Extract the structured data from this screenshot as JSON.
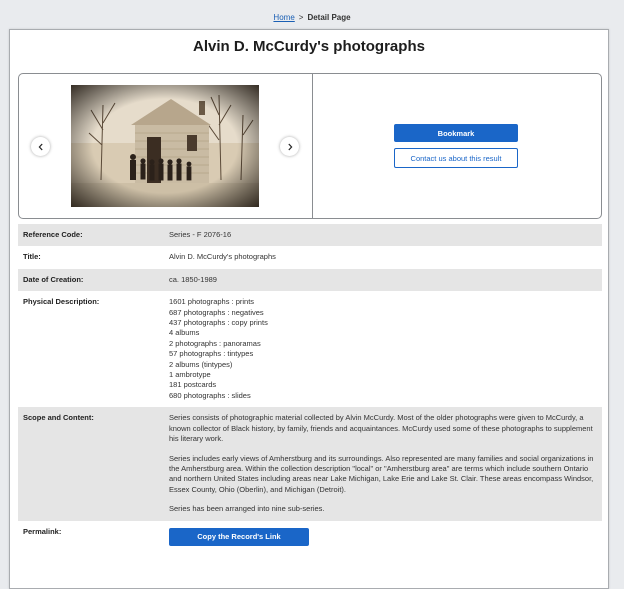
{
  "breadcrumb": {
    "home": "Home",
    "separator": ">",
    "current": "Detail Page"
  },
  "page": {
    "title": "Alvin D. McCurdy's photographs"
  },
  "media": {
    "prev_icon": "chevron-left-icon",
    "next_icon": "chevron-right-icon",
    "bookmark_label": "Bookmark",
    "contact_label": "Contact us about this result"
  },
  "details": {
    "reference_code": {
      "label": "Reference Code:",
      "value": "Series - F 2076-16"
    },
    "title": {
      "label": "Title:",
      "value": "Alvin D. McCurdy's photographs"
    },
    "date": {
      "label": "Date of Creation:",
      "value": "ca. 1850-1989"
    },
    "physical": {
      "label": "Physical Description:",
      "items": [
        "1601 photographs : prints",
        "687 photographs : negatives",
        "437 photographs : copy prints",
        "4 albums",
        "2 photographs : panoramas",
        "57 photographs : tintypes",
        "2 albums (tintypes)",
        "1 ambrotype",
        "181 postcards",
        "680 photographs : slides"
      ]
    },
    "scope": {
      "label": "Scope and Content:",
      "paragraphs": [
        "Series consists of photographic material collected by Alvin McCurdy. Most of the older photographs were given to McCurdy, a known collector of Black history, by family, friends and acquaintances. McCurdy used some of these photographs to supplement his literary work.",
        "Series includes early views of Amherstburg and its surroundings. Also represented are many families and social organizations in the Amherstburg area. Within the collection description \"local\" or \"Amherstburg area\" are terms which include southern Ontario and northern United States including areas near Lake Michigan, Lake Erie and Lake St. Clair. These areas encompass Windsor, Essex County, Ohio (Oberlin), and Michigan (Detroit).",
        "Series has been arranged into nine sub-series."
      ]
    },
    "permalink": {
      "label": "Permalink:",
      "button": "Copy the Record's Link"
    }
  }
}
